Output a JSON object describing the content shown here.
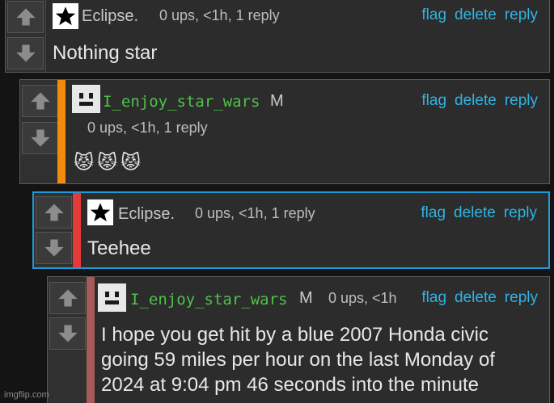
{
  "comments": [
    {
      "username": "Eclipse.",
      "avatar_icon": "star-icon",
      "mod_badge": "",
      "meta": "0 ups, <1h, 1 reply",
      "text": "Nothing star",
      "accent_color": "",
      "actions": {
        "flag": "flag",
        "delete": "delete",
        "reply": "reply"
      }
    },
    {
      "username": "I_enjoy_star_wars",
      "avatar_icon": "block-face-icon",
      "mod_badge": "M",
      "meta": "0 ups, <1h, 1 reply",
      "text": "😾😾😾",
      "accent_color": "#f28b0c",
      "actions": {
        "flag": "flag",
        "delete": "delete",
        "reply": "reply"
      }
    },
    {
      "username": "Eclipse.",
      "avatar_icon": "star-icon",
      "mod_badge": "",
      "meta": "0 ups, <1h, 1 reply",
      "text": "Teehee",
      "accent_color": "#e53a3a",
      "highlight_border": "#1d9bd6",
      "actions": {
        "flag": "flag",
        "delete": "delete",
        "reply": "reply"
      }
    },
    {
      "username": "I_enjoy_star_wars",
      "avatar_icon": "block-face-icon",
      "mod_badge": "M",
      "meta": "0 ups, <1h",
      "text_lines": [
        "I hope you get hit by a blue 2007 Honda civic",
        "going 59 miles per hour on the last Monday of",
        "2024 at 9:04 pm 46 seconds into the minute"
      ],
      "accent_color": "#a85a5a",
      "actions": {
        "flag": "flag",
        "delete": "delete",
        "reply": "reply"
      }
    }
  ],
  "watermark": "imgflip.com"
}
